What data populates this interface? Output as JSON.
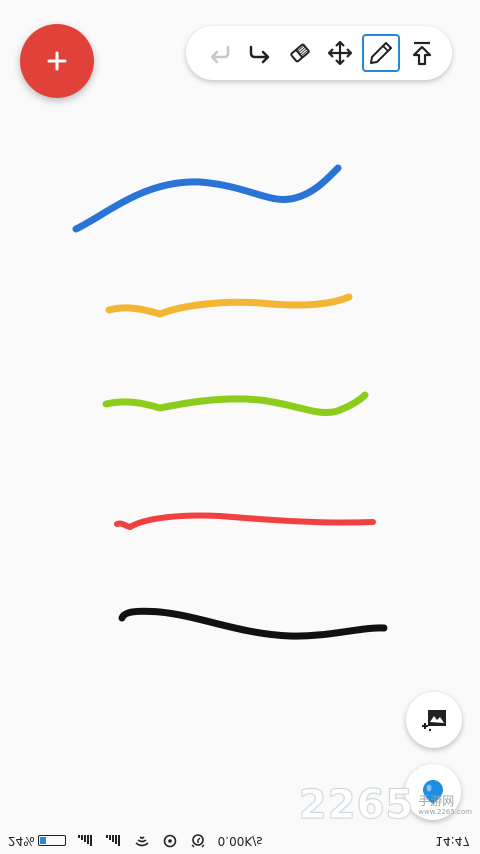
{
  "toolbar": {
    "tools": [
      {
        "name": "undo-icon",
        "enabled": false
      },
      {
        "name": "redo-icon",
        "enabled": true
      },
      {
        "name": "eraser-icon",
        "enabled": true
      },
      {
        "name": "move-icon",
        "enabled": true
      },
      {
        "name": "pencil-icon",
        "selected": true
      },
      {
        "name": "upload-icon",
        "enabled": true
      }
    ]
  },
  "colors": {
    "fab": "#e0423a",
    "accent": "#2a87d8",
    "strokes": [
      "#2a74d8",
      "#f2b534",
      "#8ccc1c",
      "#f04040",
      "#111111"
    ]
  },
  "status_bar": {
    "battery_percent": "24%",
    "battery_level": 0.24,
    "net_speed": "0.00K/s",
    "time": "14:47"
  },
  "watermark": {
    "number": "2265",
    "suffix": "com",
    "cn_text": "手游网",
    "url_text": "www.2265.com"
  }
}
